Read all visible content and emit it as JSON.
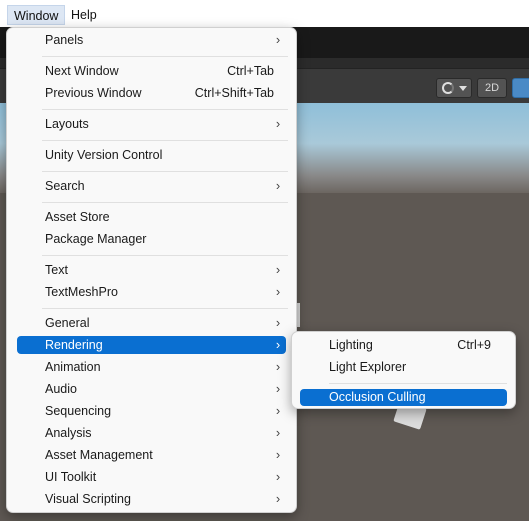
{
  "menubar": {
    "window_label": "Window",
    "help_label": "Help"
  },
  "scene_toolbar": {
    "mode_2d_label": "2D"
  },
  "window_menu": {
    "panels": "Panels",
    "next_window": "Next Window",
    "next_window_shortcut": "Ctrl+Tab",
    "previous_window": "Previous Window",
    "previous_window_shortcut": "Ctrl+Shift+Tab",
    "layouts": "Layouts",
    "unity_version_control": "Unity Version Control",
    "search": "Search",
    "asset_store": "Asset Store",
    "package_manager": "Package Manager",
    "text": "Text",
    "textmeshpro": "TextMeshPro",
    "general": "General",
    "rendering": "Rendering",
    "animation": "Animation",
    "audio": "Audio",
    "sequencing": "Sequencing",
    "analysis": "Analysis",
    "asset_management": "Asset Management",
    "ui_toolkit": "UI Toolkit",
    "visual_scripting": "Visual Scripting",
    "submenu_arrow": "›"
  },
  "rendering_submenu": {
    "lighting": "Lighting",
    "lighting_shortcut": "Ctrl+9",
    "light_explorer": "Light Explorer",
    "occlusion_culling": "Occlusion Culling"
  },
  "colors": {
    "highlight": "#0a6fd1",
    "menu_bg": "#f9f9f9",
    "scene_ground": "#5e5853"
  },
  "icons": [
    "gizmo-shading-icon",
    "dropdown-arrow-icon",
    "chevron-right-icon"
  ]
}
